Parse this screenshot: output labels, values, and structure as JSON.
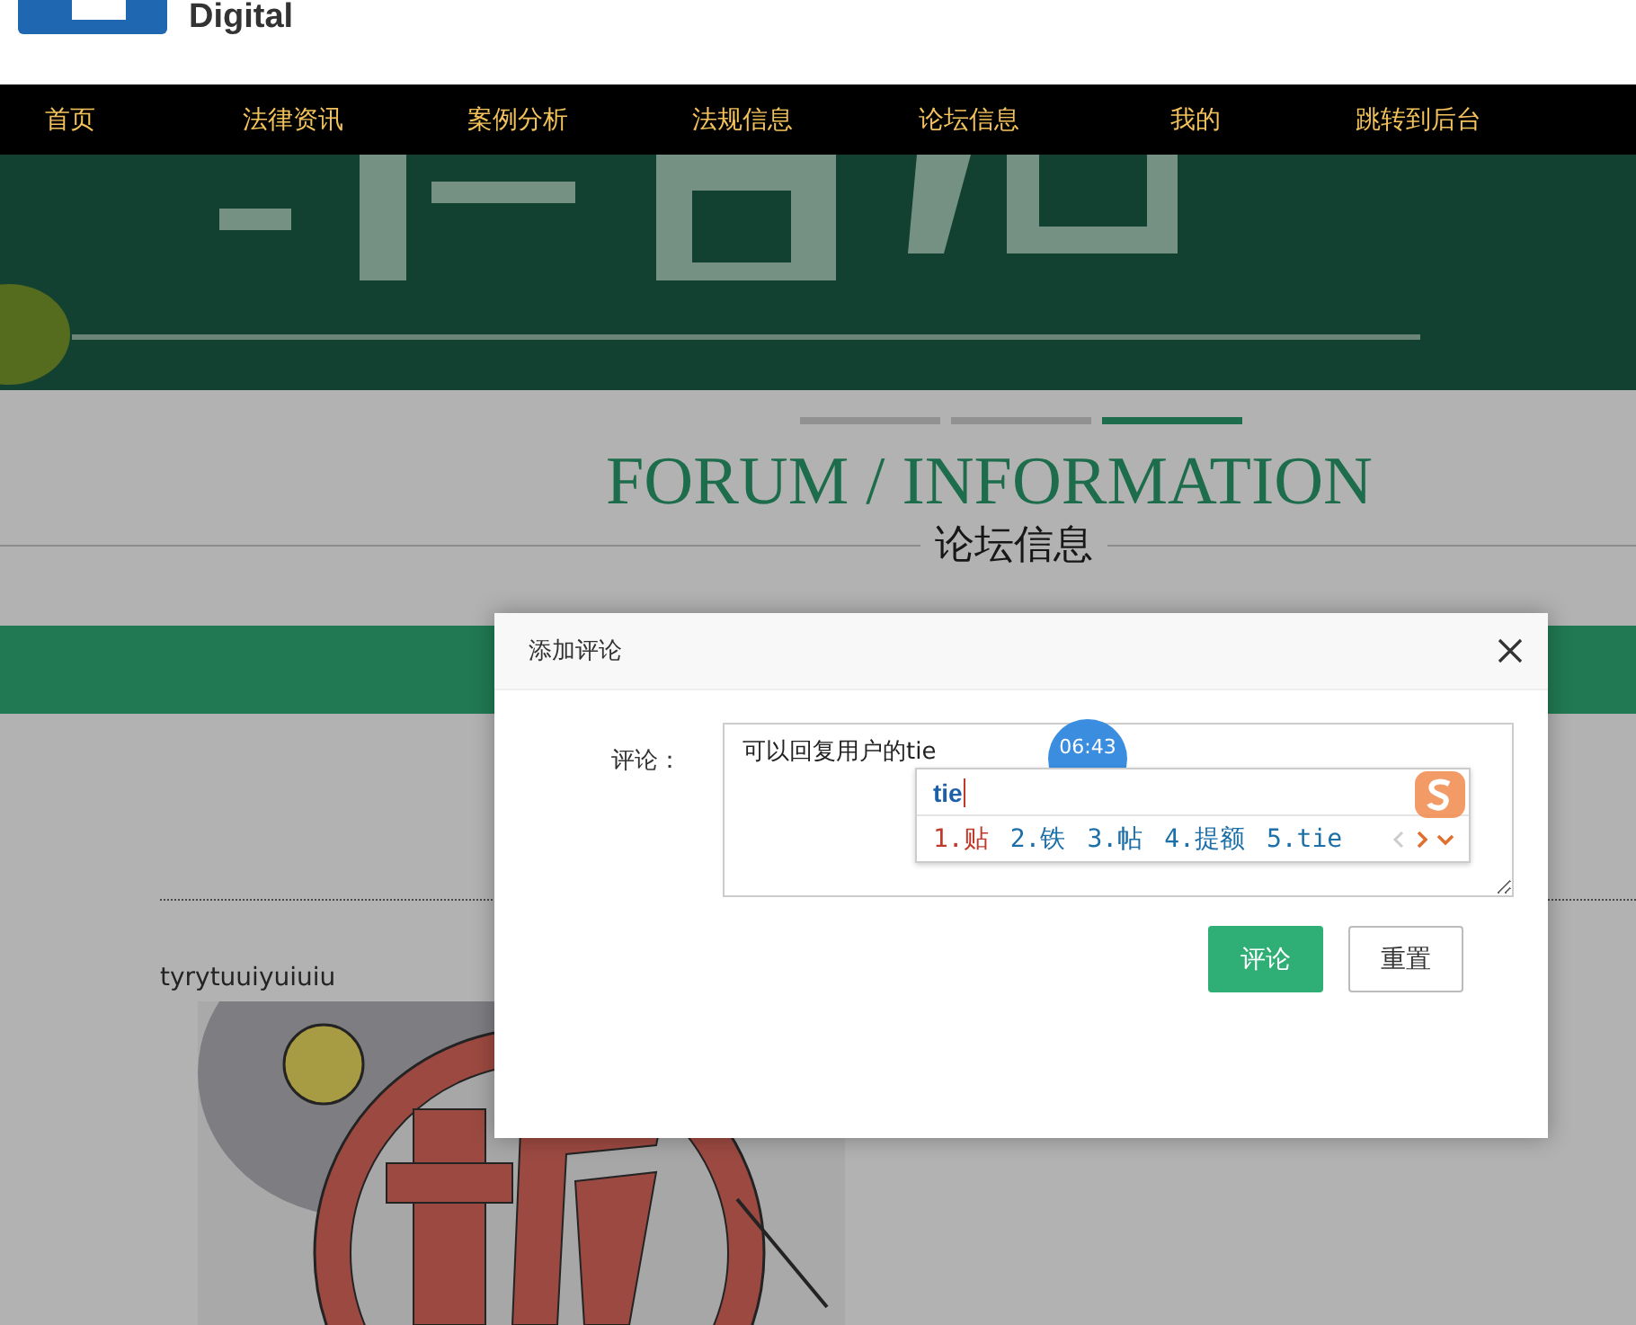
{
  "header": {
    "logo_text": "Digital"
  },
  "nav": [
    {
      "label": "首页"
    },
    {
      "label": "法律资讯"
    },
    {
      "label": "案例分析"
    },
    {
      "label": "法规信息"
    },
    {
      "label": "论坛信息"
    },
    {
      "label": "我的"
    },
    {
      "label": "跳转到后台"
    }
  ],
  "carousel_dots": [
    {
      "selected": false
    },
    {
      "selected": false
    },
    {
      "selected": true
    }
  ],
  "section": {
    "title": "FORUM / INFORMATION",
    "subtitle": "论坛信息"
  },
  "post": {
    "author": "tyrytuuiyuiuiu"
  },
  "dialog": {
    "title": "添加评论",
    "field_label": "评论：",
    "value": "可以回复用户的tie",
    "buttons": [
      {
        "label": "评论",
        "kind": "primary"
      },
      {
        "label": "重置",
        "kind": "secondary"
      }
    ]
  },
  "timer_badge": "06:43",
  "ime": {
    "composition": "tie",
    "candidates": [
      {
        "label": "1.贴",
        "selected": true
      },
      {
        "label": "2.铁",
        "selected": false
      },
      {
        "label": "3.帖",
        "selected": false
      },
      {
        "label": "4.提额",
        "selected": false
      },
      {
        "label": "5.tie",
        "selected": false
      }
    ]
  }
}
